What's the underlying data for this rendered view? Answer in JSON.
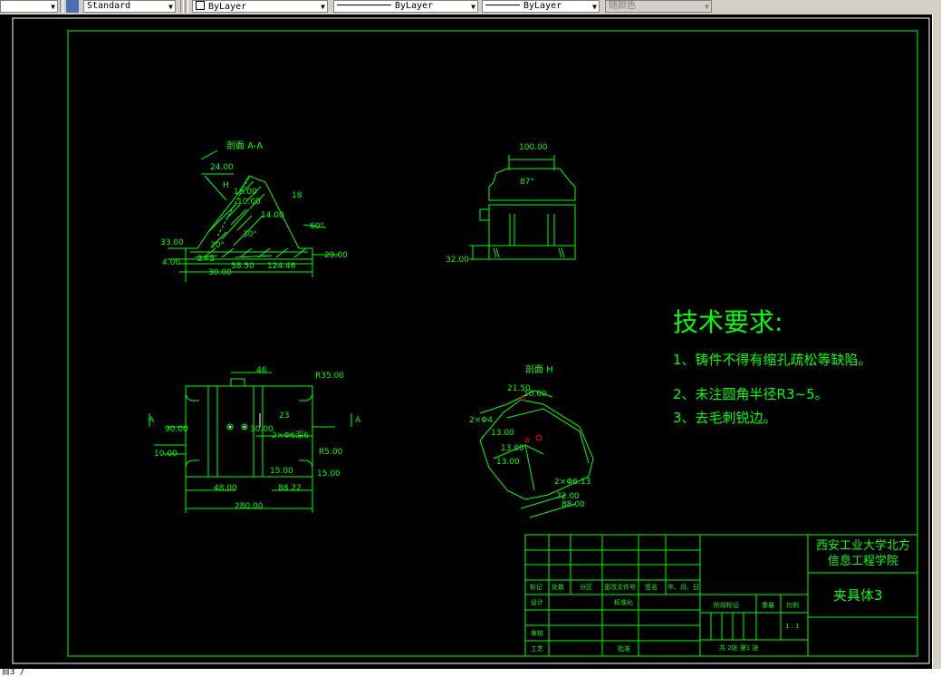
{
  "toolbar": {
    "text_style": "Standard",
    "layer": "ByLayer",
    "linetype": "ByLayer",
    "lineweight": "ByLayer",
    "plot_style": "随颜色"
  },
  "drawing": {
    "section_aa_title": "剖面 A-A",
    "section_h_title": "剖面 H",
    "tech_title": "技术要求:",
    "tech_items": [
      "1、铸件不得有缩孔疏松等缺陷。",
      "2、未注圆角半径R3~5。",
      "3、去毛刺锐边。"
    ],
    "dims_aa": [
      "24.00",
      "16.00",
      "10.00",
      "18",
      "14.00",
      "60°",
      "33.00",
      "4.00",
      "30.00",
      "58.50",
      "124.46",
      "29.00",
      "H",
      "30°",
      "20°",
      "2×5"
    ],
    "dims_top": [
      "100.00",
      "87°",
      "32.00"
    ],
    "dims_plan": [
      "46",
      "R35.00",
      "23",
      "30.00",
      "2×Φ6深6",
      "R5.00",
      "90.00",
      "10.00",
      "15.00",
      "15.00",
      "48.00",
      "88.22",
      "280.00",
      "A",
      "A"
    ],
    "dims_h": [
      "21.50",
      "10.00",
      "2×Φ4",
      "13.00",
      "13.00",
      "13.00",
      "2×Φ6.13",
      "72.00",
      "88.00"
    ],
    "title_block": {
      "school": "西安工业大学北方信息工程学院",
      "part_name": "夹具体3",
      "row_labels": [
        "标记",
        "处数",
        "分区",
        "更改文件号",
        "签名",
        "年、月、日"
      ],
      "left_labels": [
        "设计",
        "标准化",
        "审核",
        "工艺",
        "批准"
      ],
      "stage_labels": [
        "阶段标记",
        "重量",
        "比例"
      ],
      "scale": "1 : 1",
      "sheets": "共  2张        第1  张"
    }
  },
  "statusbar": {
    "text": "目3 /"
  },
  "colors": {
    "lines": "#00ff00",
    "background": "#000000",
    "red": "#ff0000",
    "white": "#ffffff"
  }
}
